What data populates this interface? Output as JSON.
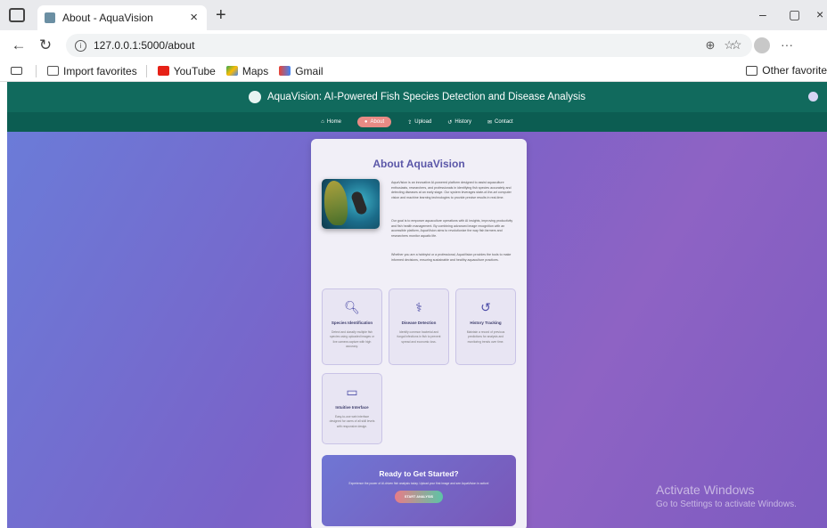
{
  "browser": {
    "tab_title": "About - AquaVision",
    "tab_close": "×",
    "new_tab": "+",
    "url": "127.0.0.1:5000/about",
    "window_controls": [
      "–",
      "▢",
      "×"
    ],
    "bookmarks": [
      {
        "label": "Import favorites",
        "icon": "import-icon",
        "color": "#555555"
      },
      {
        "label": "YouTube",
        "icon": "youtube-icon",
        "color": "#e62117"
      },
      {
        "label": "Maps",
        "icon": "maps-icon",
        "color": "#34a853"
      },
      {
        "label": "Gmail",
        "icon": "gmail-icon",
        "color": "#ea4335"
      }
    ],
    "other_favorites": "Other favorite"
  },
  "site": {
    "header_title": "AquaVision: AI-Powered Fish Species Detection and Disease Analysis",
    "nav": [
      {
        "label": "Home",
        "icon": "⌂",
        "active": false
      },
      {
        "label": "About",
        "icon": "●",
        "active": true
      },
      {
        "label": "Upload",
        "icon": "⇪",
        "active": false
      },
      {
        "label": "History",
        "icon": "↺",
        "active": false
      },
      {
        "label": "Contact",
        "icon": "✉",
        "active": false
      }
    ],
    "accent": "#116a5d",
    "title_color": "#5b57a8"
  },
  "about": {
    "title": "About AquaVision",
    "paragraphs": [
      "AquaVision is an innovative AI-powered platform designed to assist aquaculture enthusiasts, researchers, and professionals in identifying fish species accurately and detecting diseases at an early stage. Our system leverages state-of-the-art computer vision and machine learning technologies to provide precise results in real-time.",
      "Our goal is to empower aquaculture operations with AI insights, improving productivity and fish health management. By combining advanced image recognition with an accessible platform, AquaVision aims to revolutionize the way fish farmers and researchers monitor aquatic life.",
      "Whether you are a hobbyist or a professional, AquaVision provides the tools to make informed decisions, ensuring sustainable and healthy aquaculture practices."
    ],
    "features": [
      {
        "icon": "search-icon",
        "glyph": "🔍︎",
        "title": "Species Identification",
        "desc": "Detect and classify multiple fish species using uploaded images or live camera capture with high accuracy."
      },
      {
        "icon": "stethoscope-icon",
        "glyph": "⚕",
        "title": "Disease Detection",
        "desc": "Identify common bacterial and fungal infections in fish to prevent spread and economic loss."
      },
      {
        "icon": "history-icon",
        "glyph": "↺",
        "title": "History Tracking",
        "desc": "Maintain a record of previous predictions for analysis and monitoring trends over time."
      },
      {
        "icon": "laptop-icon",
        "glyph": "▭",
        "title": "Intuitive Interface",
        "desc": "Easy-to-use web interface designed for users of all skill levels with responsive design."
      }
    ],
    "cta": {
      "title": "Ready to Get Started?",
      "subtitle": "Experience the power of AI-driven fish analysis today. Upload your first image and see AquaVision in action!",
      "button": "START ANALYSIS"
    }
  },
  "watermark": {
    "line1": "Activate Windows",
    "line2": "Go to Settings to activate Windows."
  }
}
